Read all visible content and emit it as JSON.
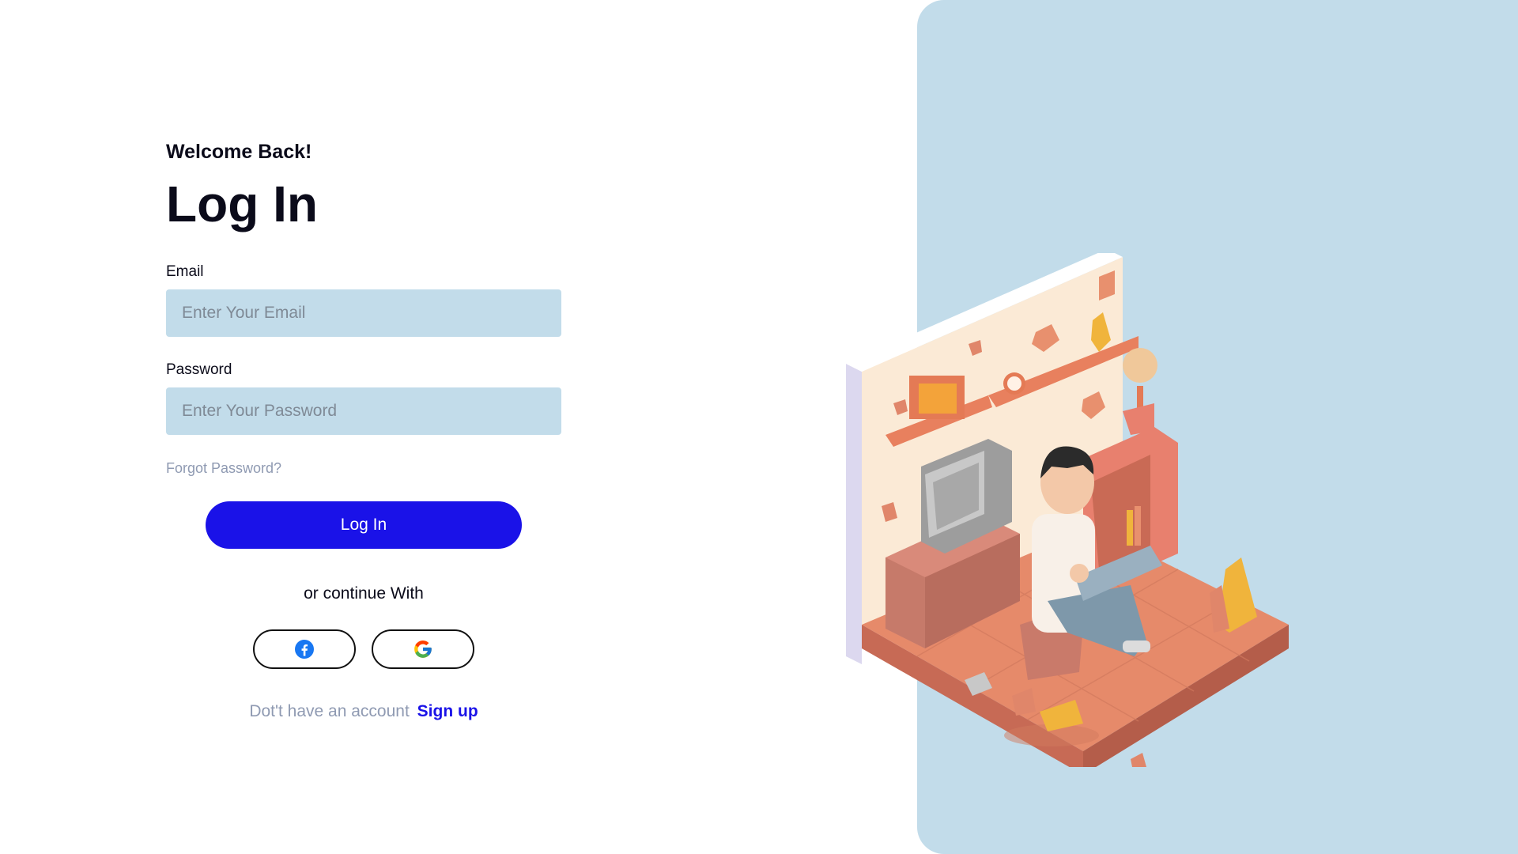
{
  "header": {
    "welcome": "Welcome Back!",
    "title": "Log In"
  },
  "form": {
    "email_label": "Email",
    "email_placeholder": "Enter Your Email",
    "email_value": "",
    "password_label": "Password",
    "password_placeholder": "Enter Your Password",
    "password_value": "",
    "forgot_password": "Forgot Password?",
    "login_button": "Log In"
  },
  "social": {
    "divider_text": "or continue With",
    "buttons": [
      {
        "name": "facebook",
        "icon": "facebook-icon"
      },
      {
        "name": "google",
        "icon": "google-icon"
      }
    ]
  },
  "signup": {
    "prompt": "Dot't have an account",
    "link": "Sign up"
  },
  "colors": {
    "accent": "#1a12e8",
    "panel": "#c2dcea",
    "input_bg": "#c2dcea",
    "muted_text": "#8f9ab2"
  },
  "illustration": {
    "icon": "isometric-room-illustration"
  }
}
